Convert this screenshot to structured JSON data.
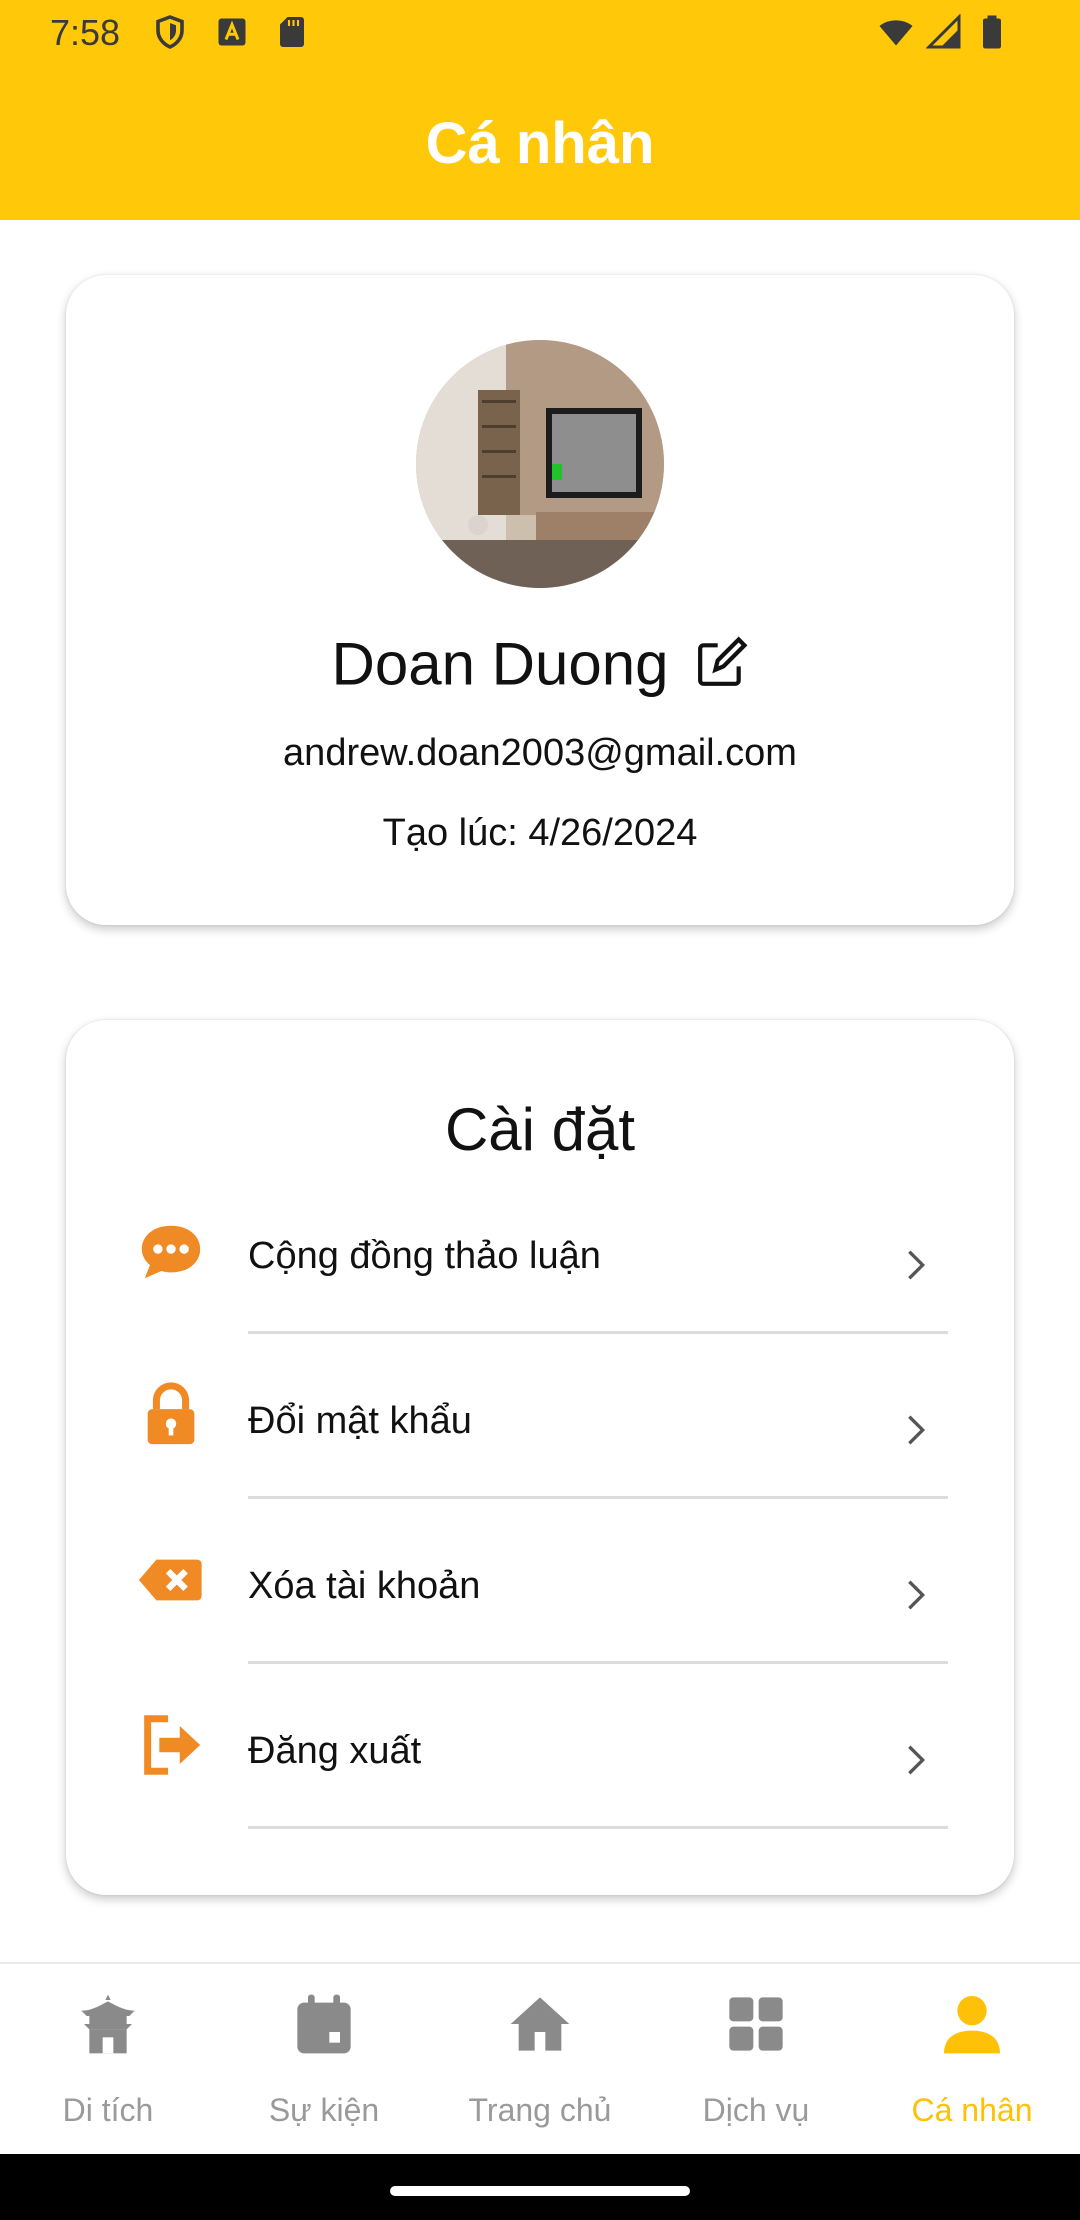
{
  "status_bar": {
    "time": "7:58",
    "icons": [
      "shield-icon",
      "font-a-icon",
      "sd-card-icon",
      "wifi-icon",
      "signal-icon",
      "battery-icon"
    ]
  },
  "header": {
    "title": "Cá nhân",
    "background": "#FFC90A"
  },
  "profile": {
    "name": "Doan Duong",
    "email": "andrew.doan2003@gmail.com",
    "created": "Tạo lúc: 4/26/2024"
  },
  "settings": {
    "title": "Cài đặt",
    "items": [
      {
        "label": "Cộng đồng thảo luận",
        "icon": "chat-bubble-icon"
      },
      {
        "label": "Đổi mật khẩu",
        "icon": "lock-icon"
      },
      {
        "label": "Xóa tài khoản",
        "icon": "backspace-delete-icon"
      },
      {
        "label": "Đăng xuất",
        "icon": "logout-icon"
      }
    ],
    "icon_color": "#F08A24"
  },
  "bottom_nav": {
    "items": [
      {
        "label": "Di tích",
        "icon": "temple-icon"
      },
      {
        "label": "Sự kiện",
        "icon": "calendar-icon"
      },
      {
        "label": "Trang chủ",
        "icon": "home-icon"
      },
      {
        "label": "Dịch vụ",
        "icon": "grid-icon"
      },
      {
        "label": "Cá nhân",
        "icon": "person-icon"
      }
    ],
    "active_index": 4,
    "active_color": "#FFC107",
    "inactive_color": "#8A8A8A"
  }
}
